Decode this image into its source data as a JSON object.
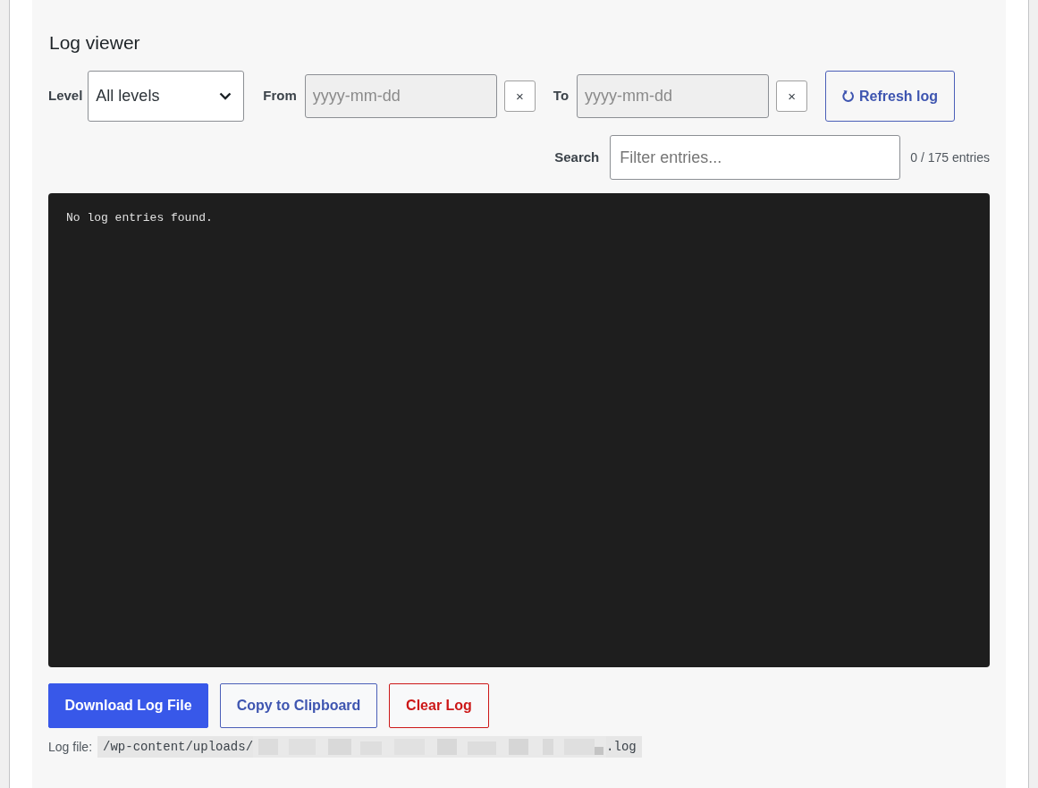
{
  "title": "Log viewer",
  "filters": {
    "level": {
      "label": "Level",
      "value": "All levels"
    },
    "dates": [
      {
        "label": "From",
        "placeholder": "yyyy-mm-dd",
        "clear": "×"
      },
      {
        "label": "To",
        "placeholder": "yyyy-mm-dd",
        "clear": "×"
      }
    ],
    "refresh": {
      "label": "Refresh log"
    }
  },
  "search": {
    "label": "Search",
    "placeholder": "Filter entries...",
    "count": "0 / 175 entries"
  },
  "log": {
    "message": "No log entries found."
  },
  "actions": [
    {
      "kind": "primary",
      "label": "Download Log File"
    },
    {
      "kind": "secondary",
      "label": "Copy to Clipboard"
    },
    {
      "kind": "danger",
      "label": "Clear Log"
    }
  ],
  "log_file": {
    "label": "Log file:",
    "path_start": "/wp-content/uploads/",
    "path_end": ".log"
  }
}
